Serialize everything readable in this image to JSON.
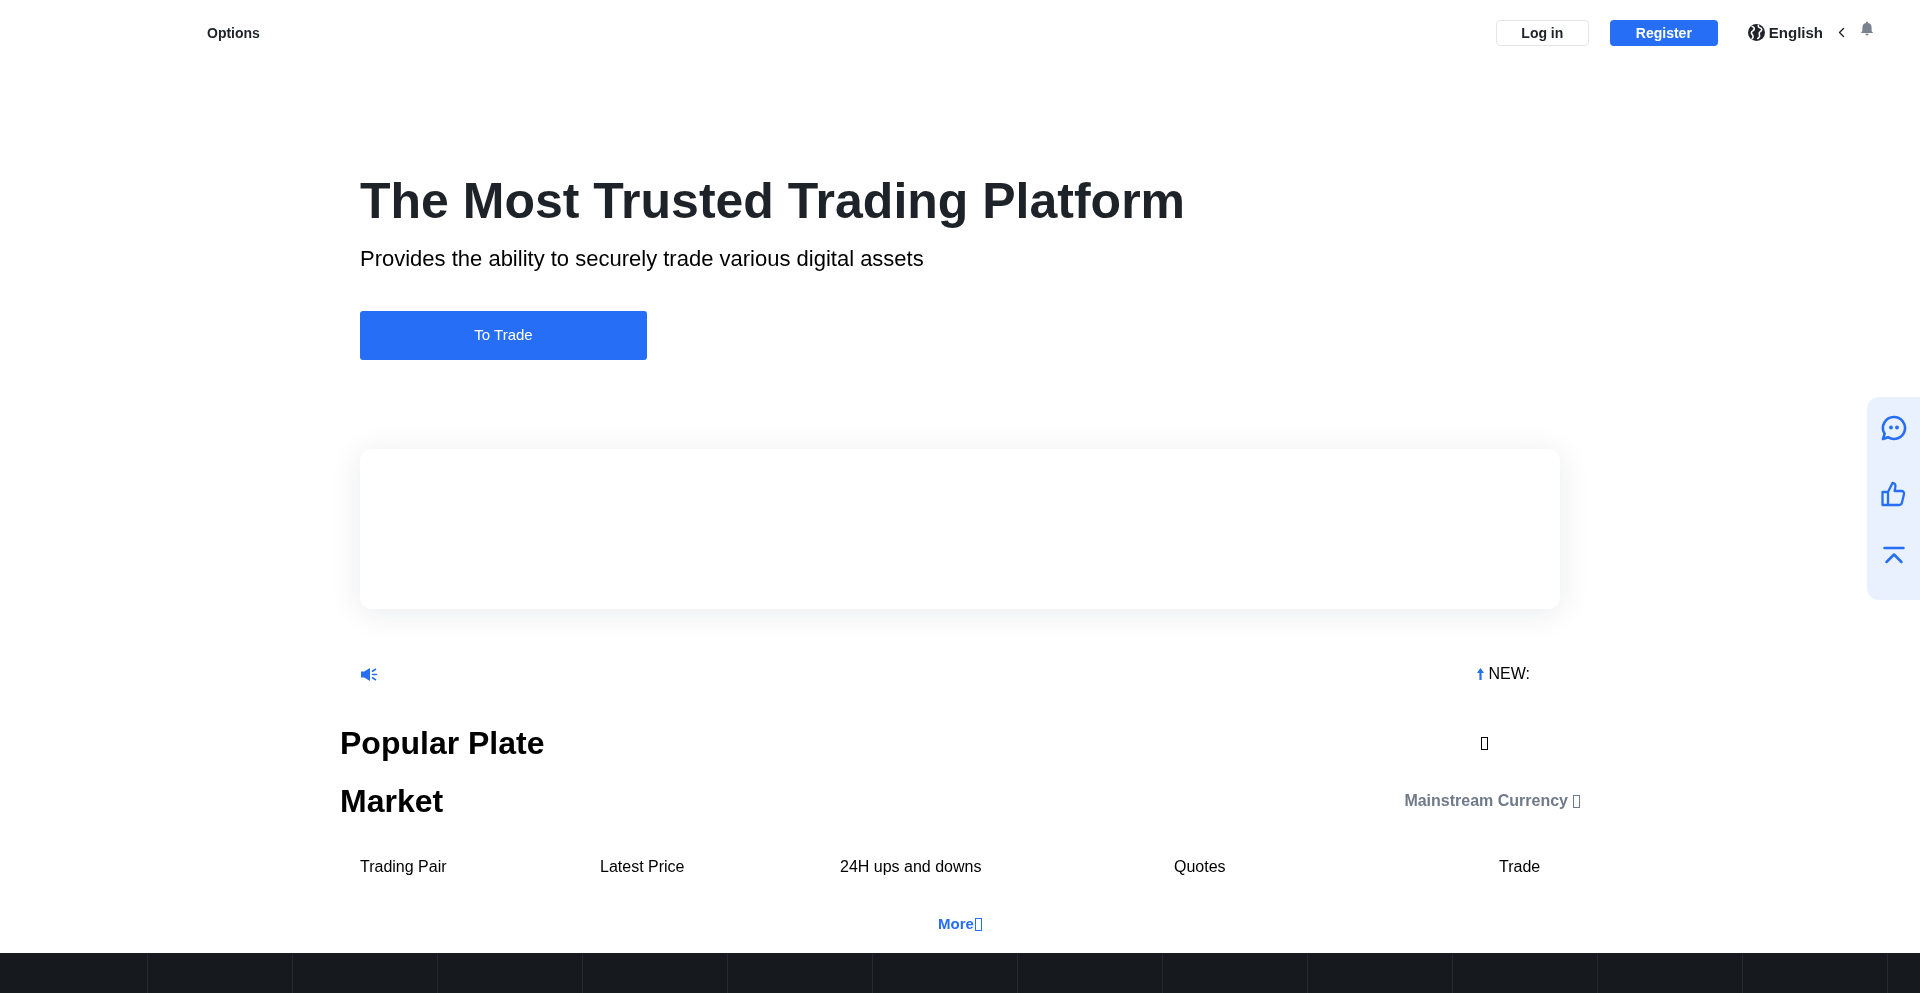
{
  "nav": {
    "links": [
      {
        "label": "Options"
      }
    ],
    "login_button": "Log in",
    "register_button": "Register",
    "language": "English"
  },
  "hero": {
    "title": "The Most Trusted Trading Platform",
    "subtitle": "Provides the ability to securely trade various digital assets",
    "cta_button": "To Trade"
  },
  "notice_bar": {
    "label": "NEW:"
  },
  "popular_plate": {
    "title": "Popular Plate"
  },
  "market": {
    "title": "Market",
    "filter": "Mainstream Currency",
    "columns": [
      "Trading Pair",
      "Latest Price",
      "24H ups and downs",
      "Quotes",
      "Trade"
    ],
    "more_link": "More"
  }
}
